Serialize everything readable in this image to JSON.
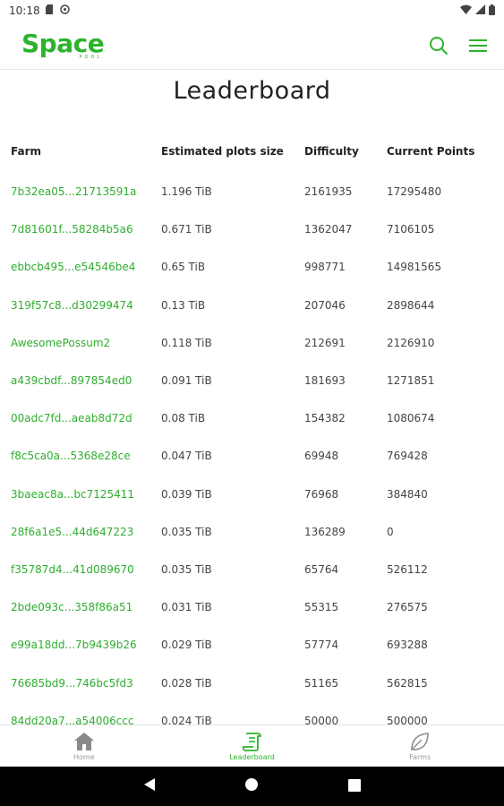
{
  "status_bar": {
    "time": "10:18"
  },
  "app": {
    "logo_main": "Space",
    "logo_sub": "POOL"
  },
  "page": {
    "title": "Leaderboard"
  },
  "table": {
    "headers": {
      "farm": "Farm",
      "size": "Estimated plots size",
      "difficulty": "Difficulty",
      "points": "Current Points"
    },
    "rows": [
      {
        "farm": "7b32ea05...21713591a",
        "size": "1.196 TiB",
        "difficulty": "2161935",
        "points": "17295480"
      },
      {
        "farm": "7d81601f...58284b5a6",
        "size": "0.671 TiB",
        "difficulty": "1362047",
        "points": "7106105"
      },
      {
        "farm": "ebbcb495...e54546be4",
        "size": "0.65 TiB",
        "difficulty": "998771",
        "points": "14981565"
      },
      {
        "farm": "319f57c8...d30299474",
        "size": "0.13 TiB",
        "difficulty": "207046",
        "points": "2898644"
      },
      {
        "farm": "AwesomePossum2",
        "size": "0.118 TiB",
        "difficulty": "212691",
        "points": "2126910"
      },
      {
        "farm": "a439cbdf...897854ed0",
        "size": "0.091 TiB",
        "difficulty": "181693",
        "points": "1271851"
      },
      {
        "farm": "00adc7fd...aeab8d72d",
        "size": "0.08 TiB",
        "difficulty": "154382",
        "points": "1080674"
      },
      {
        "farm": "f8c5ca0a...5368e28ce",
        "size": "0.047 TiB",
        "difficulty": "69948",
        "points": "769428"
      },
      {
        "farm": "3baeac8a...bc7125411",
        "size": "0.039 TiB",
        "difficulty": "76968",
        "points": "384840"
      },
      {
        "farm": "28f6a1e5...44d647223",
        "size": "0.035 TiB",
        "difficulty": "136289",
        "points": "0"
      },
      {
        "farm": "f35787d4...41d089670",
        "size": "0.035 TiB",
        "difficulty": "65764",
        "points": "526112"
      },
      {
        "farm": "2bde093c...358f86a51",
        "size": "0.031 TiB",
        "difficulty": "55315",
        "points": "276575"
      },
      {
        "farm": "e99a18dd...7b9439b26",
        "size": "0.029 TiB",
        "difficulty": "57774",
        "points": "693288"
      },
      {
        "farm": "76685bd9...746bc5fd3",
        "size": "0.028 TiB",
        "difficulty": "51165",
        "points": "562815"
      },
      {
        "farm": "84dd20a7...a54006ccc",
        "size": "0.024 TiB",
        "difficulty": "50000",
        "points": "500000"
      }
    ]
  },
  "bottom_nav": [
    {
      "label": "Home",
      "icon": "home-icon",
      "active": false
    },
    {
      "label": "Leaderboard",
      "icon": "leaderboard-icon",
      "active": true
    },
    {
      "label": "Farms",
      "icon": "leaf-icon",
      "active": false
    }
  ],
  "colors": {
    "accent": "#2cb32c",
    "link": "#2fae2f",
    "text": "#222222",
    "muted": "#9a9a9a"
  }
}
